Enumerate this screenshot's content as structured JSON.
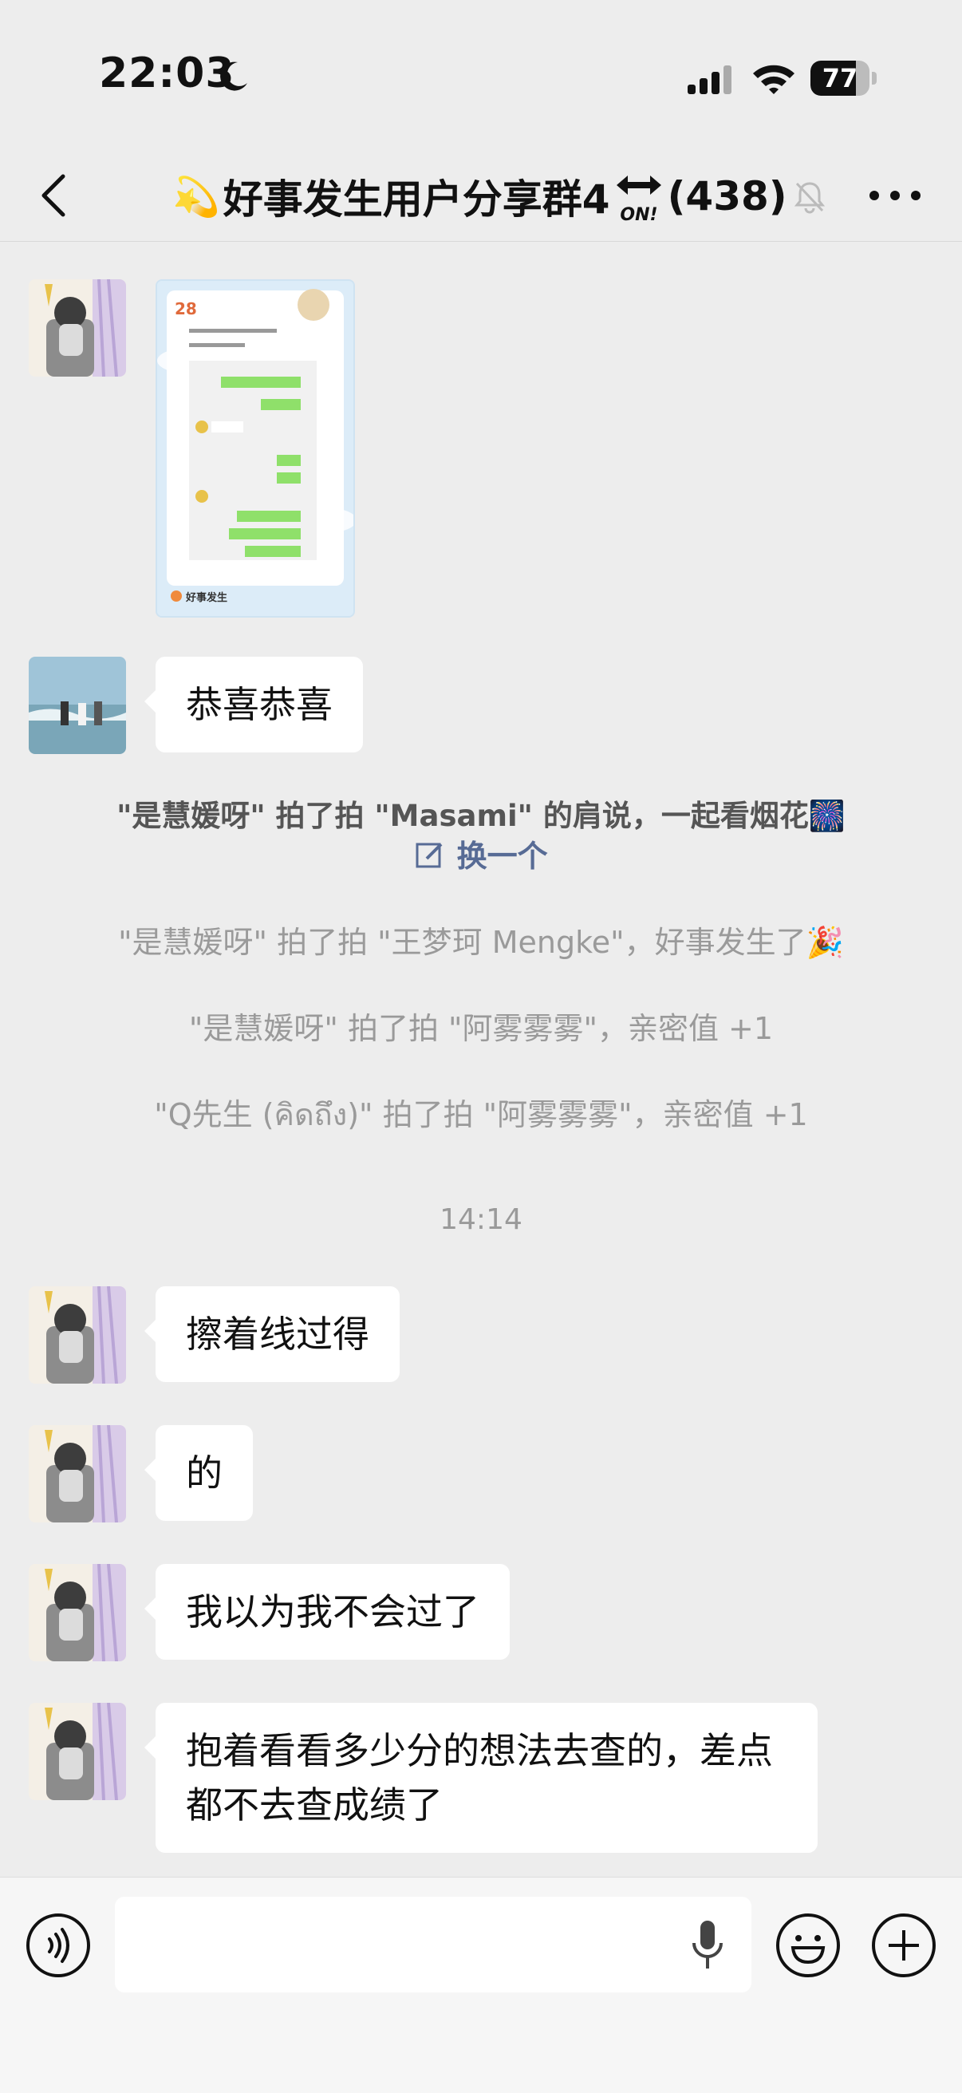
{
  "status_bar": {
    "time": "22:03",
    "battery": "77",
    "battery_level": 0.77
  },
  "header": {
    "title_emoji": "💫",
    "title": "好事发生用户分享群4",
    "member_count": "(438)",
    "icons": [
      "back-arrow-icon",
      "arrows-on-icon",
      "mute-bell-icon",
      "more-dots-icon"
    ]
  },
  "messages": [
    {
      "type": "image",
      "avatar": "anime-girl-avatar",
      "card": {
        "date": "28",
        "brand": "好事发生"
      }
    },
    {
      "type": "text",
      "avatar": "beach-avatar",
      "text": "恭喜恭喜"
    }
  ],
  "system": {
    "pat_fireworks": "\"是慧媛呀\" 拍了拍 \"Masami\" 的肩说，一起看烟花🎆",
    "change_link": "换一个",
    "pat_mengke": "\"是慧媛呀\" 拍了拍 \"王梦珂 Mengke\"，好事发生了🎉",
    "pat_wu1": "\"是慧媛呀\" 拍了拍 \"阿雾雾雾\"，亲密值 +1",
    "pat_wu2": "\"Q先生 (คิดถึง)\" 拍了拍 \"阿雾雾雾\"，亲密值 +1",
    "time": "14:14"
  },
  "later_messages": [
    {
      "text": "擦着线过得"
    },
    {
      "text": "的"
    },
    {
      "text": "我以为我不会过了"
    },
    {
      "text": "抱着看看多少分的想法去查的，差点都不去查成绩了"
    }
  ],
  "input_bar": {
    "placeholder": "",
    "icons": [
      "voice-icon",
      "mic-icon",
      "emoji-icon",
      "plus-icon"
    ]
  },
  "colors": {
    "background": "#ededed",
    "bubble": "#ffffff",
    "link": "#576b95",
    "system_text": "#9a9a9a"
  }
}
